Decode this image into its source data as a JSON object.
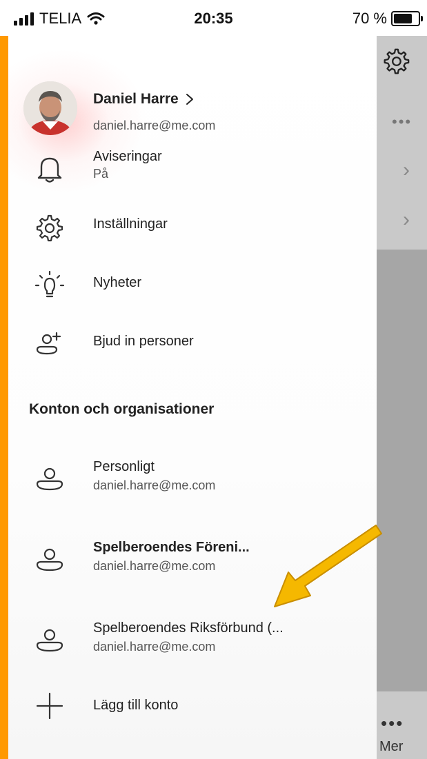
{
  "status_bar": {
    "carrier": "TELIA",
    "time": "20:35",
    "battery": "70 %"
  },
  "drawer": {
    "profile": {
      "name": "Daniel Harre",
      "email": "daniel.harre@me.com"
    },
    "menu": [
      {
        "label": "Aviseringar",
        "sub": "På",
        "icon": "bell-icon"
      },
      {
        "label": "Inställningar",
        "icon": "gear-icon"
      },
      {
        "label": "Nyheter",
        "icon": "lightbulb-icon"
      },
      {
        "label": "Bjud in personer",
        "icon": "add-person-icon"
      }
    ],
    "section_title": "Konton och organisationer",
    "accounts": [
      {
        "label": "Personligt",
        "email": "daniel.harre@me.com",
        "bold": false
      },
      {
        "label": "Spelberoendes Föreni...",
        "email": "daniel.harre@me.com",
        "bold": true
      },
      {
        "label": "Spelberoendes Riksförbund (...",
        "email": "daniel.harre@me.com",
        "bold": false
      }
    ],
    "add_account": "Lägg till konto"
  },
  "background_app": {
    "more_label": "Mer"
  },
  "colors": {
    "frame": "#FF9900",
    "arrow": "#F5B800",
    "overlay": "#A6A6A6"
  }
}
